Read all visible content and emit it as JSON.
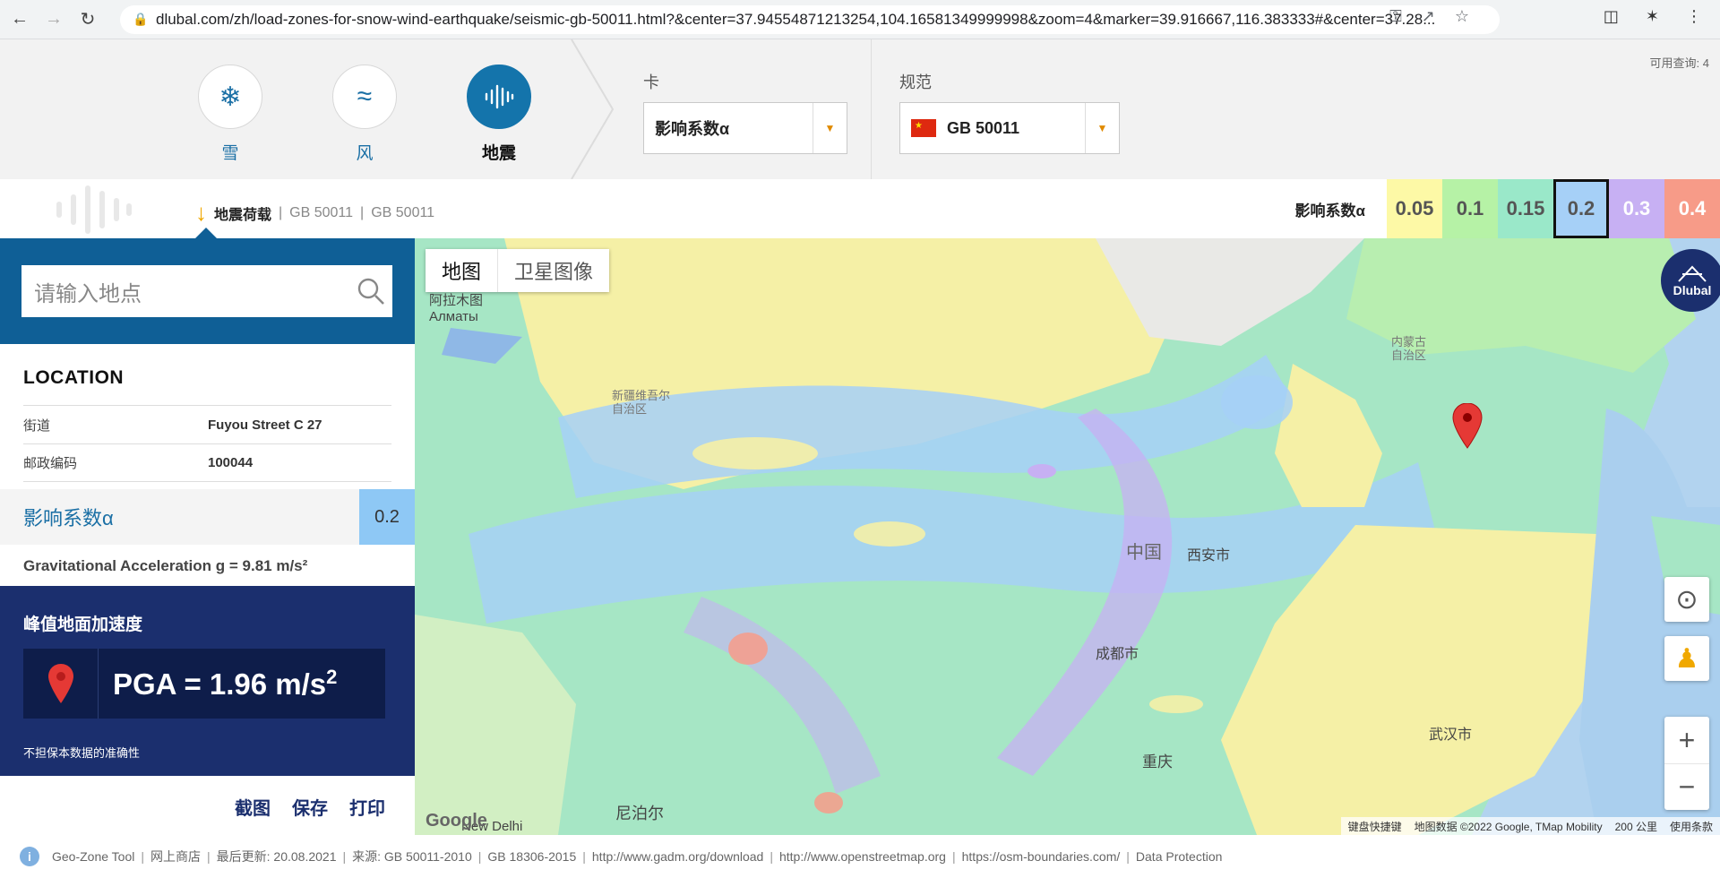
{
  "browser": {
    "url": "dlubal.com/zh/load-zones-for-snow-wind-earthquake/seismic-gb-50011.html?&center=37.94554871213254,104.16581349999998&zoom=4&marker=39.916667,116.383333#&center=37.28..."
  },
  "topnav": {
    "loads": [
      {
        "label": "雪",
        "icon": "snowflake-icon"
      },
      {
        "label": "风",
        "icon": "wind-icon"
      },
      {
        "label": "地震",
        "icon": "seismic-icon"
      }
    ],
    "map_label": "卡",
    "map_value": "影响系数α",
    "standard_label": "规范",
    "standard_value": "GB 50011",
    "available_queries": "可用查询: 4"
  },
  "infobar": {
    "breadcrumb_title": "地震荷载",
    "breadcrumb_1": "GB 50011",
    "breadcrumb_2": "GB 50011",
    "legend_title": "影响系数α",
    "legend": [
      {
        "value": "0.05",
        "color": "#fdf9a6"
      },
      {
        "value": "0.1",
        "color": "#b6f2a6"
      },
      {
        "value": "0.15",
        "color": "#9ae8c9"
      },
      {
        "value": "0.2",
        "color": "#a6d0f7"
      },
      {
        "value": "0.3",
        "color": "#c7b0f3"
      },
      {
        "value": "0.4",
        "color": "#f79b88"
      }
    ]
  },
  "sidebar": {
    "search_placeholder": "请输入地点",
    "location_heading": "LOCATION",
    "street_label": "街道",
    "street_value": "Fuyou Street C 27",
    "postcode_label": "邮政编码",
    "postcode_value": "100044",
    "factor_label": "影响系数α",
    "factor_value": "0.2",
    "gravity": "Gravitational Acceleration g = 9.81 m/s²",
    "pga_heading": "峰值地面加速度",
    "pga_value": "PGA = 1.96 m/s",
    "pga_exp": "2",
    "disclaimer": "不担保本数据的准确性",
    "actions": [
      "截图",
      "保存",
      "打印"
    ]
  },
  "map": {
    "type_map": "地图",
    "type_satellite": "卫星图像",
    "logo_text": "Dlubal",
    "google": "Google",
    "labels": {
      "almaty_cn": "阿拉木图",
      "almaty_ru": "Алматы",
      "xinjiang": "新疆维吾尔\n自治区",
      "neimenggu": "内蒙古\n自治区",
      "zhongguo": "中国",
      "xian": "西安市",
      "chengdu": "成都市",
      "chongqing": "重庆",
      "wuhan": "武汉市",
      "nepal": "尼泊尔",
      "newdelhi": "New Delhi"
    },
    "attribution": [
      "键盘快捷键",
      "地图数据 ©2022 Google, TMap Mobility",
      "200 公里",
      "使用条款"
    ]
  },
  "footer": {
    "items": [
      "Geo-Zone Tool",
      "网上商店",
      "最后更新: 20.08.2021",
      "来源: GB 50011-2010",
      "GB 18306-2015",
      "http://www.gadm.org/download",
      "http://www.openstreetmap.org",
      "https://osm-boundaries.com/",
      "Data Protection"
    ]
  }
}
